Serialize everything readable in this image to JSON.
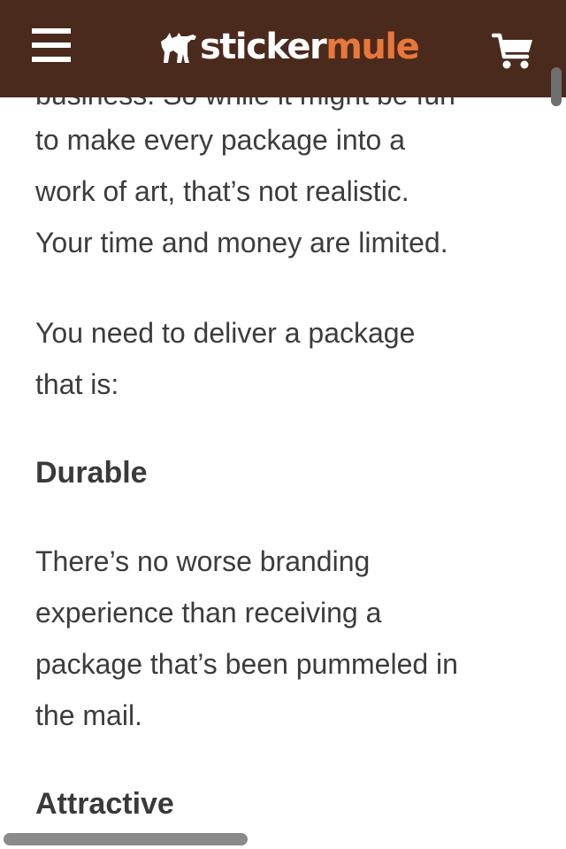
{
  "header": {
    "logo_sticker": "sticker",
    "logo_mule": "mule",
    "brand_brown": "#4a2a1c",
    "accent_orange": "#e8773a",
    "icons": {
      "menu": "hamburger-menu-icon",
      "logo": "mule-logo-icon",
      "cart": "shopping-cart-icon"
    }
  },
  "article": {
    "partial_line": "business. So while it might be fun",
    "paragraph1": [
      "to make every package into a",
      "work of art, that’s not realistic.",
      "Your time and money are limited."
    ],
    "paragraph2": [
      "You need to deliver a package",
      "that is:"
    ],
    "heading_durable": "Durable",
    "paragraph3": [
      "There’s no worse branding",
      "experience than receiving a",
      "package that’s been pummeled in",
      "the mail."
    ],
    "heading_attractive": "Attractive"
  }
}
